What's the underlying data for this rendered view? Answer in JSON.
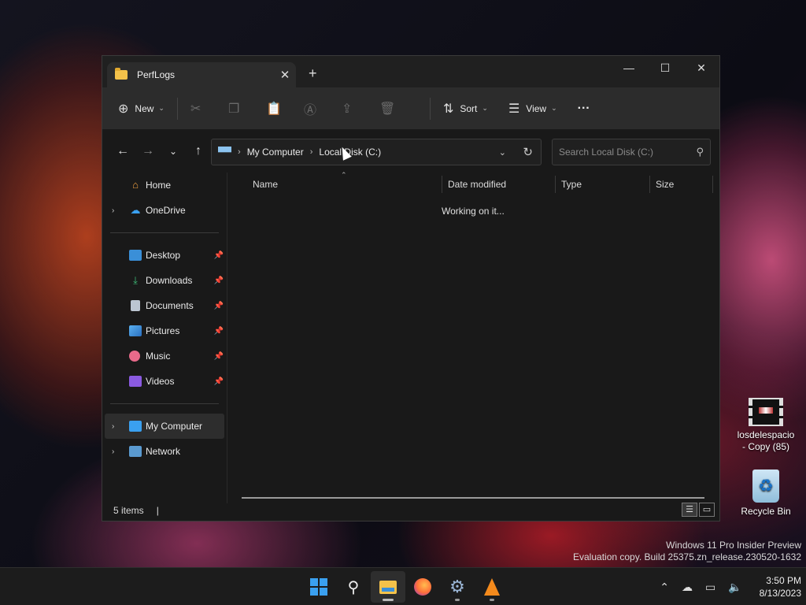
{
  "window": {
    "tab_title": "PerfLogs",
    "tab_close": "✕",
    "new_tab": "+",
    "controls": {
      "minimize": "—",
      "maximize": "☐",
      "close": "✕"
    }
  },
  "toolbar": {
    "new_label": "New",
    "sort_label": "Sort",
    "view_label": "View",
    "more": "···"
  },
  "address": {
    "root_icon": "pc-icon",
    "crumbs": [
      "My Computer",
      "Local Disk (C:)"
    ]
  },
  "search": {
    "placeholder": "Search Local Disk (C:)"
  },
  "sidebar": {
    "top": [
      {
        "label": "Home",
        "icon": "home-icon"
      },
      {
        "label": "OneDrive",
        "icon": "cloud-icon"
      }
    ],
    "quick": [
      {
        "label": "Desktop",
        "icon": "desktop-icon"
      },
      {
        "label": "Downloads",
        "icon": "download-icon"
      },
      {
        "label": "Documents",
        "icon": "document-icon"
      },
      {
        "label": "Pictures",
        "icon": "pictures-icon"
      },
      {
        "label": "Music",
        "icon": "music-icon"
      },
      {
        "label": "Videos",
        "icon": "videos-icon"
      }
    ],
    "bottom": [
      {
        "label": "My Computer",
        "icon": "computer-icon",
        "selected": true
      },
      {
        "label": "Network",
        "icon": "network-icon"
      }
    ]
  },
  "columns": {
    "name": "Name",
    "date_modified": "Date modified",
    "type": "Type",
    "size": "Size"
  },
  "content": {
    "status_message": "Working on it..."
  },
  "statusbar": {
    "items": "5 items",
    "cursor": "|"
  },
  "desktop": {
    "icons": [
      {
        "label_line1": "losdelespacio",
        "label_line2": "- Copy (85)"
      },
      {
        "label_line1": "Recycle Bin"
      }
    ],
    "watermark": {
      "line1": "Windows 11 Pro Insider Preview",
      "line2": "Evaluation copy. Build 25375.zn_release.230520-1632"
    }
  },
  "taskbar": {
    "clock_time": "3:50 PM",
    "clock_date": "8/13/2023"
  },
  "colors": {
    "accent": "#3aa0f0",
    "folder": "#f4c24a",
    "window_bg": "#191919",
    "toolbar_bg": "#2c2c2c"
  }
}
